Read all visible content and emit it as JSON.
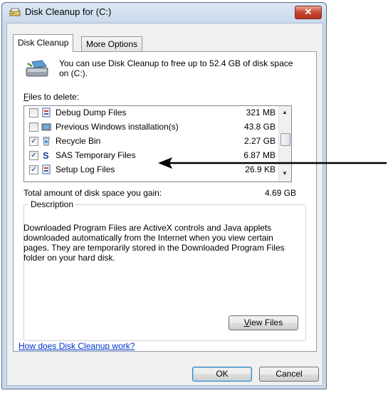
{
  "window": {
    "title": "Disk Cleanup for  (C:)",
    "close_glyph": "✕"
  },
  "tabs": [
    {
      "label": "Disk Cleanup",
      "active": true
    },
    {
      "label": "More Options",
      "active": false
    }
  ],
  "info": {
    "text": "You can use Disk Cleanup to free up to 52.4 GB of disk space on  (C:)."
  },
  "files_label": "Files to delete:",
  "files": [
    {
      "name": "Debug Dump Files",
      "size": "321 MB",
      "checked": false,
      "icon": "report-icon"
    },
    {
      "name": "Previous Windows installation(s)",
      "size": "43.8 GB",
      "checked": false,
      "icon": "windows-installation-icon"
    },
    {
      "name": "Recycle Bin",
      "size": "2.27 GB",
      "checked": true,
      "icon": "recycle-bin-icon"
    },
    {
      "name": "SAS Temporary Files",
      "size": "6.87 MB",
      "checked": true,
      "icon": "sas-icon"
    },
    {
      "name": "Setup Log Files",
      "size": "26.9 KB",
      "checked": true,
      "icon": "log-file-icon"
    }
  ],
  "total": {
    "label": "Total amount of disk space you gain:",
    "value": "4.69 GB"
  },
  "description": {
    "legend": "Description",
    "text": "Downloaded Program Files are ActiveX controls and Java applets downloaded automatically from the Internet when you view certain pages. They are temporarily stored in the Downloaded Program Files folder on your hard disk."
  },
  "buttons": {
    "view_files": "View Files",
    "ok": "OK",
    "cancel": "Cancel"
  },
  "help_link": "How does Disk Cleanup work?",
  "colors": {
    "link": "#0033cc",
    "close": "#c9462f",
    "annotation_arrow": "#000000"
  }
}
